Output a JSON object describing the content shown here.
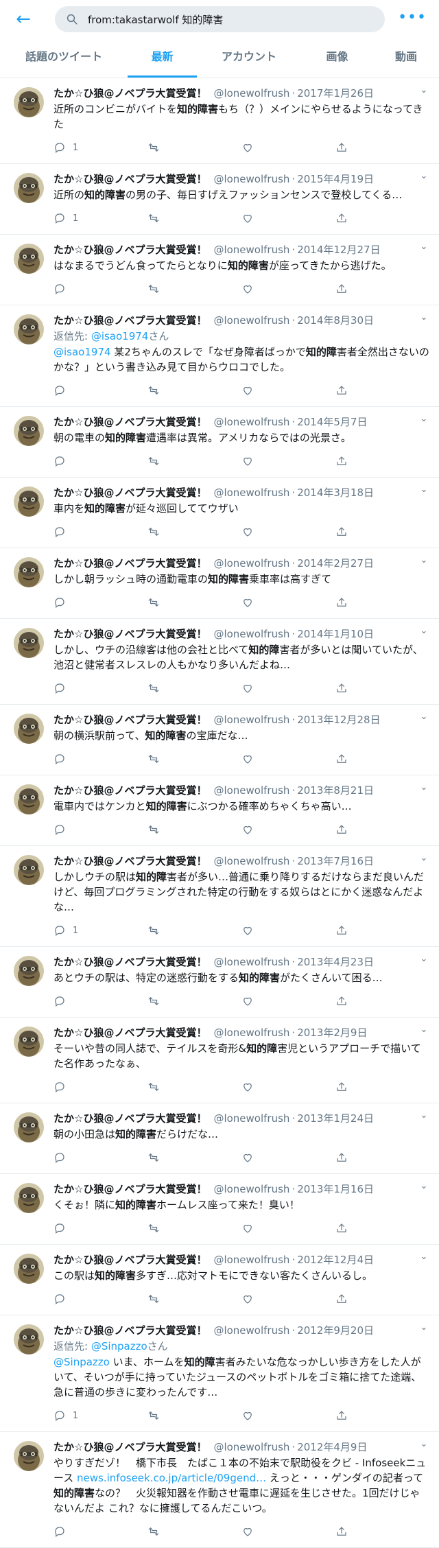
{
  "search": {
    "query": "from:takastarwolf 知的障害"
  },
  "icons": {
    "back": "back-arrow-icon",
    "search": "search-icon",
    "more": "more-icon"
  },
  "tabs": [
    {
      "label": "話題のツイート",
      "active": false
    },
    {
      "label": "最新",
      "active": true
    },
    {
      "label": "アカウント",
      "active": false
    },
    {
      "label": "画像",
      "active": false
    },
    {
      "label": "動画",
      "active": false
    }
  ],
  "accent_color": "#1da1f2",
  "tweets": [
    {
      "name": "たか☆ひ狼@ノベプラ大賞受賞！",
      "handle": "@lonewolfrush",
      "date": "2017年1月26日",
      "segments": [
        {
          "t": "近所のコンビニがバイトを"
        },
        {
          "t": "知的障害",
          "b": true
        },
        {
          "t": "もち（？）メインにやらせるようになってきた"
        }
      ],
      "replies": "1"
    },
    {
      "name": "たか☆ひ狼@ノベプラ大賞受賞！",
      "handle": "@lonewolfrush",
      "date": "2015年4月19日",
      "segments": [
        {
          "t": "近所の"
        },
        {
          "t": "知的障害",
          "b": true
        },
        {
          "t": "の男の子、毎日すげえファッションセンスで登校してくる…"
        }
      ],
      "replies": "1"
    },
    {
      "name": "たか☆ひ狼@ノベプラ大賞受賞！",
      "handle": "@lonewolfrush",
      "date": "2014年12月27日",
      "segments": [
        {
          "t": "はなまるでうどん食ってたらとなりに"
        },
        {
          "t": "知的障害",
          "b": true
        },
        {
          "t": "が座ってきたから逃げた。"
        }
      ],
      "replies": ""
    },
    {
      "name": "たか☆ひ狼@ノベプラ大賞受賞！",
      "handle": "@lonewolfrush",
      "date": "2014年8月30日",
      "reply_prefix": "返信先: ",
      "reply_mention": "@isao1974",
      "reply_suffix": "さん",
      "segments": [
        {
          "t": "@isao1974",
          "m": true
        },
        {
          "t": " 某2ちゃんのスレで「なぜ身障者ばっかで"
        },
        {
          "t": "知的障",
          "b": true
        },
        {
          "t": "害者全然出さないのかな？」という書き込み見て目からウロコでした。"
        }
      ],
      "replies": ""
    },
    {
      "name": "たか☆ひ狼@ノベプラ大賞受賞！",
      "handle": "@lonewolfrush",
      "date": "2014年5月7日",
      "segments": [
        {
          "t": "朝の電車の"
        },
        {
          "t": "知的障害",
          "b": true
        },
        {
          "t": "遭遇率は異常。アメリカならではの光景さ。"
        }
      ],
      "replies": ""
    },
    {
      "name": "たか☆ひ狼@ノベプラ大賞受賞！",
      "handle": "@lonewolfrush",
      "date": "2014年3月18日",
      "segments": [
        {
          "t": "車内を"
        },
        {
          "t": "知的障害",
          "b": true
        },
        {
          "t": "が延々巡回しててウザい"
        }
      ],
      "replies": ""
    },
    {
      "name": "たか☆ひ狼@ノベプラ大賞受賞！",
      "handle": "@lonewolfrush",
      "date": "2014年2月27日",
      "segments": [
        {
          "t": "しかし朝ラッシュ時の通勤電車の"
        },
        {
          "t": "知的障害",
          "b": true
        },
        {
          "t": "乗車率は高すぎて"
        }
      ],
      "replies": ""
    },
    {
      "name": "たか☆ひ狼@ノベプラ大賞受賞！",
      "handle": "@lonewolfrush",
      "date": "2014年1月10日",
      "segments": [
        {
          "t": "しかし、ウチの沿線客は他の会社と比べて"
        },
        {
          "t": "知的障",
          "b": true
        },
        {
          "t": "害者が多いとは聞いていたが、池沼と健常者スレスレの人もかなり多いんだよね…"
        }
      ],
      "replies": ""
    },
    {
      "name": "たか☆ひ狼@ノベプラ大賞受賞！",
      "handle": "@lonewolfrush",
      "date": "2013年12月28日",
      "segments": [
        {
          "t": "朝の横浜駅前って、"
        },
        {
          "t": "知的障害",
          "b": true
        },
        {
          "t": "の宝庫だな…"
        }
      ],
      "replies": ""
    },
    {
      "name": "たか☆ひ狼@ノベプラ大賞受賞！",
      "handle": "@lonewolfrush",
      "date": "2013年8月21日",
      "segments": [
        {
          "t": "電車内ではケンカと"
        },
        {
          "t": "知的障害",
          "b": true
        },
        {
          "t": "にぶつかる確率めちゃくちゃ高い…"
        }
      ],
      "replies": ""
    },
    {
      "name": "たか☆ひ狼@ノベプラ大賞受賞！",
      "handle": "@lonewolfrush",
      "date": "2013年7月16日",
      "segments": [
        {
          "t": "しかしウチの駅は"
        },
        {
          "t": "知的障",
          "b": true
        },
        {
          "t": "害者が多い…普通に乗り降りするだけならまだ良いんだけど、毎回プログラミングされた特定の行動をする奴らはとにかく迷惑なんだよな…"
        }
      ],
      "replies": "1"
    },
    {
      "name": "たか☆ひ狼@ノベプラ大賞受賞！",
      "handle": "@lonewolfrush",
      "date": "2013年4月23日",
      "segments": [
        {
          "t": "あとウチの駅は、特定の迷惑行動をする"
        },
        {
          "t": "知的障害",
          "b": true
        },
        {
          "t": "がたくさんいて困る…"
        }
      ],
      "replies": ""
    },
    {
      "name": "たか☆ひ狼@ノベプラ大賞受賞！",
      "handle": "@lonewolfrush",
      "date": "2013年2月9日",
      "segments": [
        {
          "t": "そーいや昔の同人誌で、テイルスを奇形&"
        },
        {
          "t": "知的障",
          "b": true
        },
        {
          "t": "害児というアプローチで描いてた名作あったなぁ、"
        }
      ],
      "replies": ""
    },
    {
      "name": "たか☆ひ狼@ノベプラ大賞受賞！",
      "handle": "@lonewolfrush",
      "date": "2013年1月24日",
      "segments": [
        {
          "t": "朝の小田急は"
        },
        {
          "t": "知的障害",
          "b": true
        },
        {
          "t": "だらけだな…"
        }
      ],
      "replies": ""
    },
    {
      "name": "たか☆ひ狼@ノベプラ大賞受賞！",
      "handle": "@lonewolfrush",
      "date": "2013年1月16日",
      "segments": [
        {
          "t": "くそぉ！隣に"
        },
        {
          "t": "知的障害",
          "b": true
        },
        {
          "t": "ホームレス座って来た！臭い！"
        }
      ],
      "replies": ""
    },
    {
      "name": "たか☆ひ狼@ノベプラ大賞受賞！",
      "handle": "@lonewolfrush",
      "date": "2012年12月4日",
      "segments": [
        {
          "t": "この駅は"
        },
        {
          "t": "知的障害",
          "b": true
        },
        {
          "t": "多すぎ…応対マトモにできない客たくさんいるし。"
        }
      ],
      "replies": ""
    },
    {
      "name": "たか☆ひ狼@ノベプラ大賞受賞！",
      "handle": "@lonewolfrush",
      "date": "2012年9月20日",
      "reply_prefix": "返信先: ",
      "reply_mention": "@Sinpazzo",
      "reply_suffix": "さん",
      "segments": [
        {
          "t": "@Sinpazzo",
          "m": true
        },
        {
          "t": " いま、ホームを"
        },
        {
          "t": "知的障",
          "b": true
        },
        {
          "t": "害者みたいな危なっかしい歩き方をした人がいて、そいつが手に持っていたジュースのペットボトルをゴミ箱に捨てた途端、急に普通の歩きに変わったんです…"
        }
      ],
      "replies": "1"
    },
    {
      "name": "たか☆ひ狼@ノベプラ大賞受賞！",
      "handle": "@lonewolfrush",
      "date": "2012年4月9日",
      "segments": [
        {
          "t": "やりすぎだゾ！　橋下市長　たばこ１本の不始末で駅助役をクビ - Infoseekニュース "
        },
        {
          "t": "news.infoseek.co.jp/article/09gend…",
          "m": true
        },
        {
          "t": " えっと・・・ゲンダイの記者って"
        },
        {
          "t": "知的障害",
          "b": true
        },
        {
          "t": "なの？　火災報知器を作動させ電車に遅延を生じさせた。1回だけじゃないんだよ これ？なに擁護してるんだこいつ。"
        }
      ],
      "replies": ""
    }
  ]
}
